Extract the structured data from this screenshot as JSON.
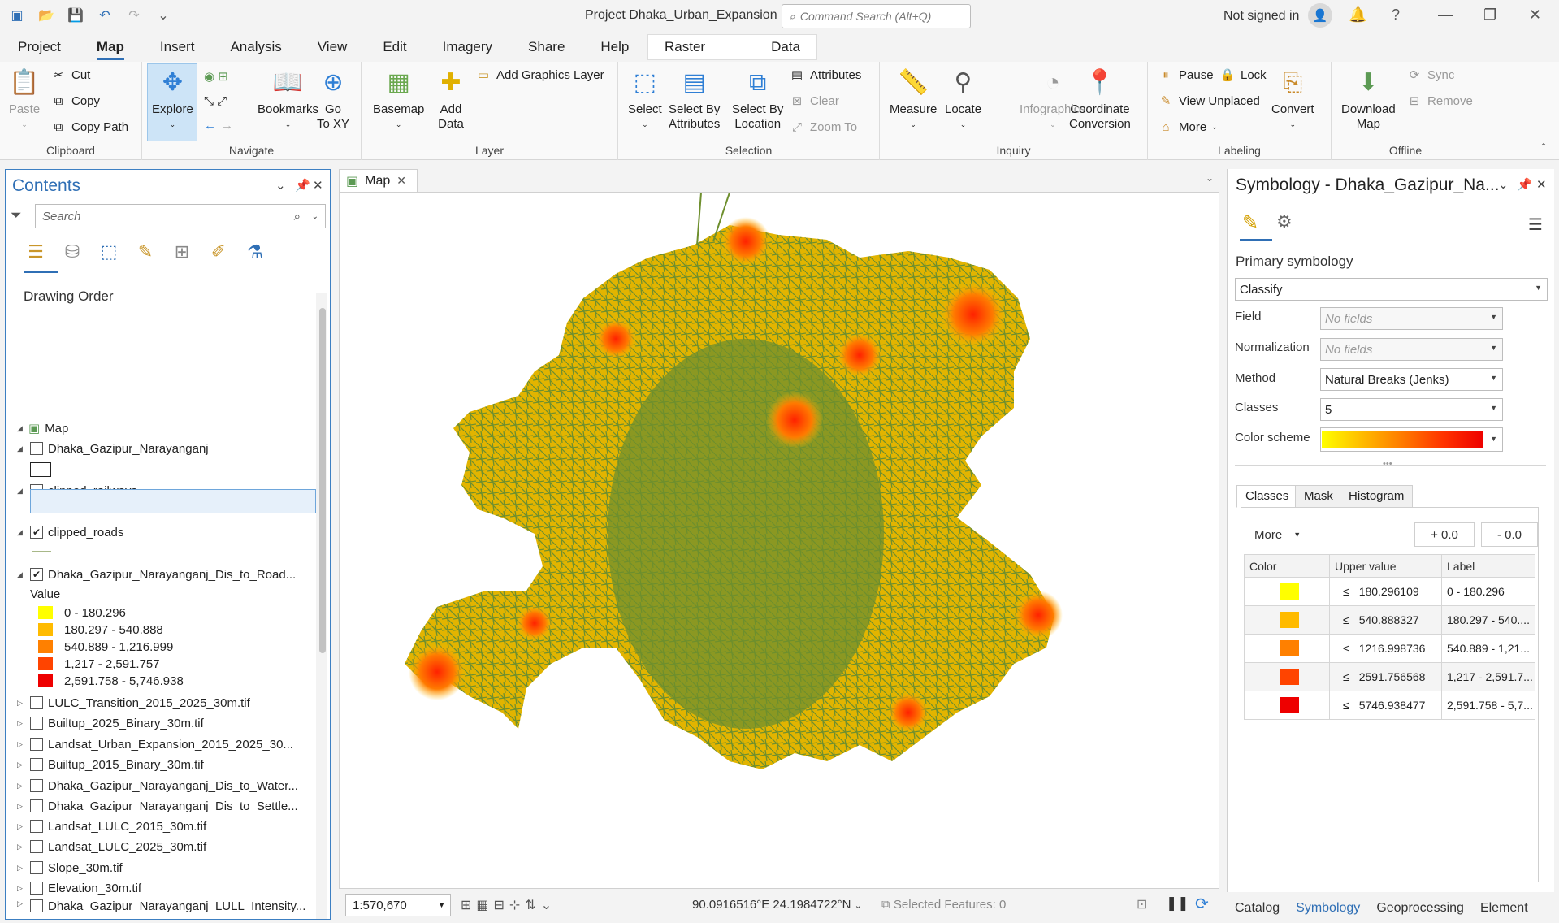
{
  "titlebar": {
    "title": "Project Dhaka_Urban_Expansion",
    "search_placeholder": "Command Search (Alt+Q)",
    "signin": "Not signed in"
  },
  "tabs": [
    "Project",
    "Map",
    "Insert",
    "Analysis",
    "View",
    "Edit",
    "Imagery",
    "Share",
    "Help"
  ],
  "active_tab": "Map",
  "context_tabs": [
    "Raster Layer",
    "Data"
  ],
  "ribbon": {
    "clipboard": {
      "label": "Clipboard",
      "paste": "Paste",
      "cut": "Cut",
      "copy": "Copy",
      "copy_path": "Copy Path"
    },
    "navigate": {
      "label": "Navigate",
      "explore": "Explore",
      "bookmarks": "Bookmarks",
      "goto": "Go",
      "goto2": "To XY"
    },
    "layer": {
      "label": "Layer",
      "basemap": "Basemap",
      "add_data": "Add",
      "add_data2": "Data",
      "add_graphics": "Add Graphics Layer"
    },
    "selection": {
      "label": "Selection",
      "select": "Select",
      "select_attr": "Select By",
      "select_attr2": "Attributes",
      "select_loc": "Select By",
      "select_loc2": "Location",
      "attributes": "Attributes",
      "clear": "Clear",
      "zoom_to": "Zoom To"
    },
    "inquiry": {
      "label": "Inquiry",
      "measure": "Measure",
      "locate": "Locate",
      "infographics": "Infographics",
      "coord": "Coordinate",
      "coord2": "Conversion"
    },
    "labeling": {
      "label": "Labeling",
      "pause": "Pause",
      "lock": "Lock",
      "view_unplaced": "View Unplaced",
      "more": "More",
      "convert": "Convert"
    },
    "offline": {
      "label": "Offline",
      "download": "Download",
      "download2": "Map",
      "sync": "Sync",
      "remove": "Remove"
    }
  },
  "contents": {
    "title": "Contents",
    "search_placeholder": "Search",
    "drawing_order": "Drawing Order",
    "map_label": "Map",
    "layers_top": [
      {
        "name": "Dhaka_Gazipur_Narayanganj",
        "checked": false
      },
      {
        "name": "clipped_railways",
        "checked": false
      },
      {
        "name": "clipped_roads",
        "checked": true
      },
      {
        "name": "Dhaka_Gazipur_Narayanganj_Dis_to_Road...",
        "checked": true
      }
    ],
    "value_label": "Value",
    "legend": [
      {
        "label": "0 - 180.296",
        "color": "#ffff00"
      },
      {
        "label": "180.297 - 540.888",
        "color": "#ffbb00"
      },
      {
        "label": "540.889 - 1,216.999",
        "color": "#ff8000"
      },
      {
        "label": "1,217 - 2,591.757",
        "color": "#ff4400"
      },
      {
        "label": "2,591.758 - 5,746.938",
        "color": "#ee0000"
      }
    ],
    "layers_bottom": [
      "LULC_Transition_2015_2025_30m.tif",
      "Builtup_2025_Binary_30m.tif",
      "Landsat_Urban_Expansion_2015_2025_30...",
      "Builtup_2015_Binary_30m.tif",
      "Dhaka_Gazipur_Narayanganj_Dis_to_Water...",
      "Dhaka_Gazipur_Narayanganj_Dis_to_Settle...",
      "Landsat_LULC_2015_30m.tif",
      "Landsat_LULC_2025_30m.tif",
      "Slope_30m.tif",
      "Elevation_30m.tif",
      "Dhaka_Gazipur_Narayanganj_LULL_Intensity..."
    ]
  },
  "map": {
    "tab_label": "Map",
    "scale": "1:570,670",
    "coords": "90.0916516°E 24.1984722°N",
    "selected_features": "Selected Features: 0"
  },
  "symbology": {
    "title": "Symbology - Dhaka_Gazipur_Na...",
    "primary": "Primary symbology",
    "renderer": "Classify",
    "field_label": "Field",
    "field_value": "No fields",
    "norm_label": "Normalization",
    "norm_value": "No fields",
    "method_label": "Method",
    "method_value": "Natural Breaks (Jenks)",
    "classes_label": "Classes",
    "classes_value": "5",
    "scheme_label": "Color scheme",
    "subtabs": [
      "Classes",
      "Mask",
      "Histogram"
    ],
    "more": "More",
    "plus": "+ 0.0",
    "minus": "- 0.0",
    "table_headers": [
      "Color",
      "Upper value",
      "Label"
    ],
    "rows": [
      {
        "color": "#ffff00",
        "upper": "180.296109",
        "label": "0 - 180.296"
      },
      {
        "color": "#ffbb00",
        "upper": "540.888327",
        "label": "180.297 - 540...."
      },
      {
        "color": "#ff8000",
        "upper": "1216.998736",
        "label": "540.889 - 1,21..."
      },
      {
        "color": "#ff4400",
        "upper": "2591.756568",
        "label": "1,217 - 2,591.7..."
      },
      {
        "color": "#ee0000",
        "upper": "5746.938477",
        "label": "2,591.758 - 5,7..."
      }
    ],
    "le_symbol": "≤"
  },
  "bottom_tabs": [
    "Catalog",
    "Symbology",
    "Geoprocessing",
    "Element"
  ],
  "active_bottom_tab": "Symbology"
}
